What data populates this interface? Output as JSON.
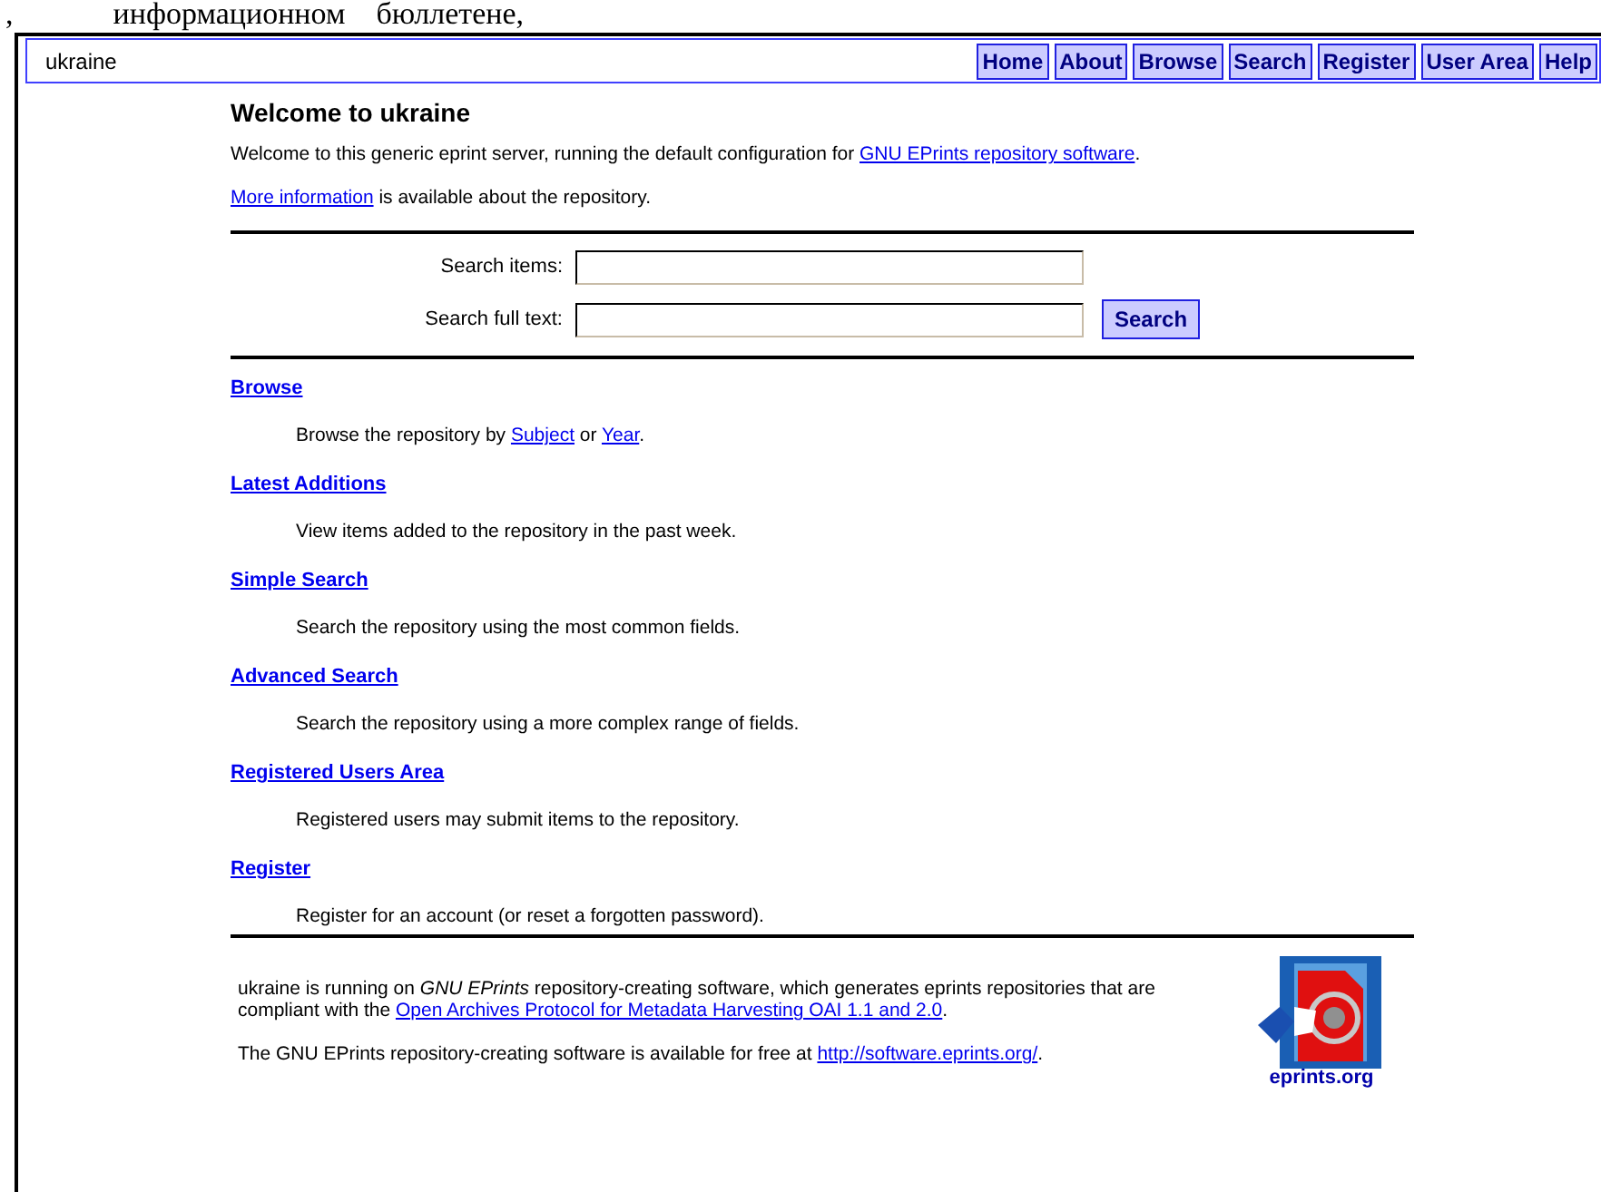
{
  "document_text": {
    "lead": ",",
    "words": "информационном    бюллетене,"
  },
  "header": {
    "site_name": "ukraine",
    "nav": [
      "Home",
      "About",
      "Browse",
      "Search",
      "Register",
      "User Area",
      "Help"
    ]
  },
  "title": "Welcome to ukraine",
  "intro": [
    [
      {
        "text": "Welcome to this generic eprint server, running the default configuration for "
      },
      {
        "text": "GNU EPrints repository software",
        "link": true
      },
      {
        "text": "."
      }
    ],
    [
      {
        "text": "More information",
        "link": true
      },
      {
        "text": " is available about the repository."
      }
    ]
  ],
  "search": {
    "fields": [
      {
        "label": "Search items:"
      },
      {
        "label": "Search full text:"
      }
    ],
    "button": "Search"
  },
  "sections": [
    {
      "title": "Browse",
      "description": [
        {
          "text": "Browse the repository by "
        },
        {
          "text": "Subject",
          "link": true
        },
        {
          "text": " or "
        },
        {
          "text": "Year",
          "link": true
        },
        {
          "text": "."
        }
      ]
    },
    {
      "title": "Latest Additions",
      "description": [
        {
          "text": "View items added to the repository in the past week."
        }
      ]
    },
    {
      "title": "Simple Search",
      "description": [
        {
          "text": "Search the repository using the most common fields."
        }
      ]
    },
    {
      "title": "Advanced Search",
      "description": [
        {
          "text": "Search the repository using a more complex range of fields."
        }
      ]
    },
    {
      "title": "Registered Users Area",
      "description": [
        {
          "text": "Registered users may submit items to the repository."
        }
      ]
    },
    {
      "title": "Register",
      "description": [
        {
          "text": "Register for an account (or reset a forgotten password)."
        }
      ]
    }
  ],
  "footer": {
    "paragraphs": [
      [
        {
          "text": "ukraine is running on *GNU EPrints* repository-creating software, which generates eprints repositories that are compliant with the "
        },
        {
          "text": "Open Archives Protocol for Metadata Harvesting OAI 1.1 and 2.0",
          "link": true
        },
        {
          "text": "."
        }
      ],
      [
        {
          "text": "The GNU EPrints repository-creating software is available for free at "
        },
        {
          "text": "http://software.eprints.org/",
          "link": true
        },
        {
          "text": "."
        }
      ]
    ],
    "logo_caption": "eprints.org"
  }
}
